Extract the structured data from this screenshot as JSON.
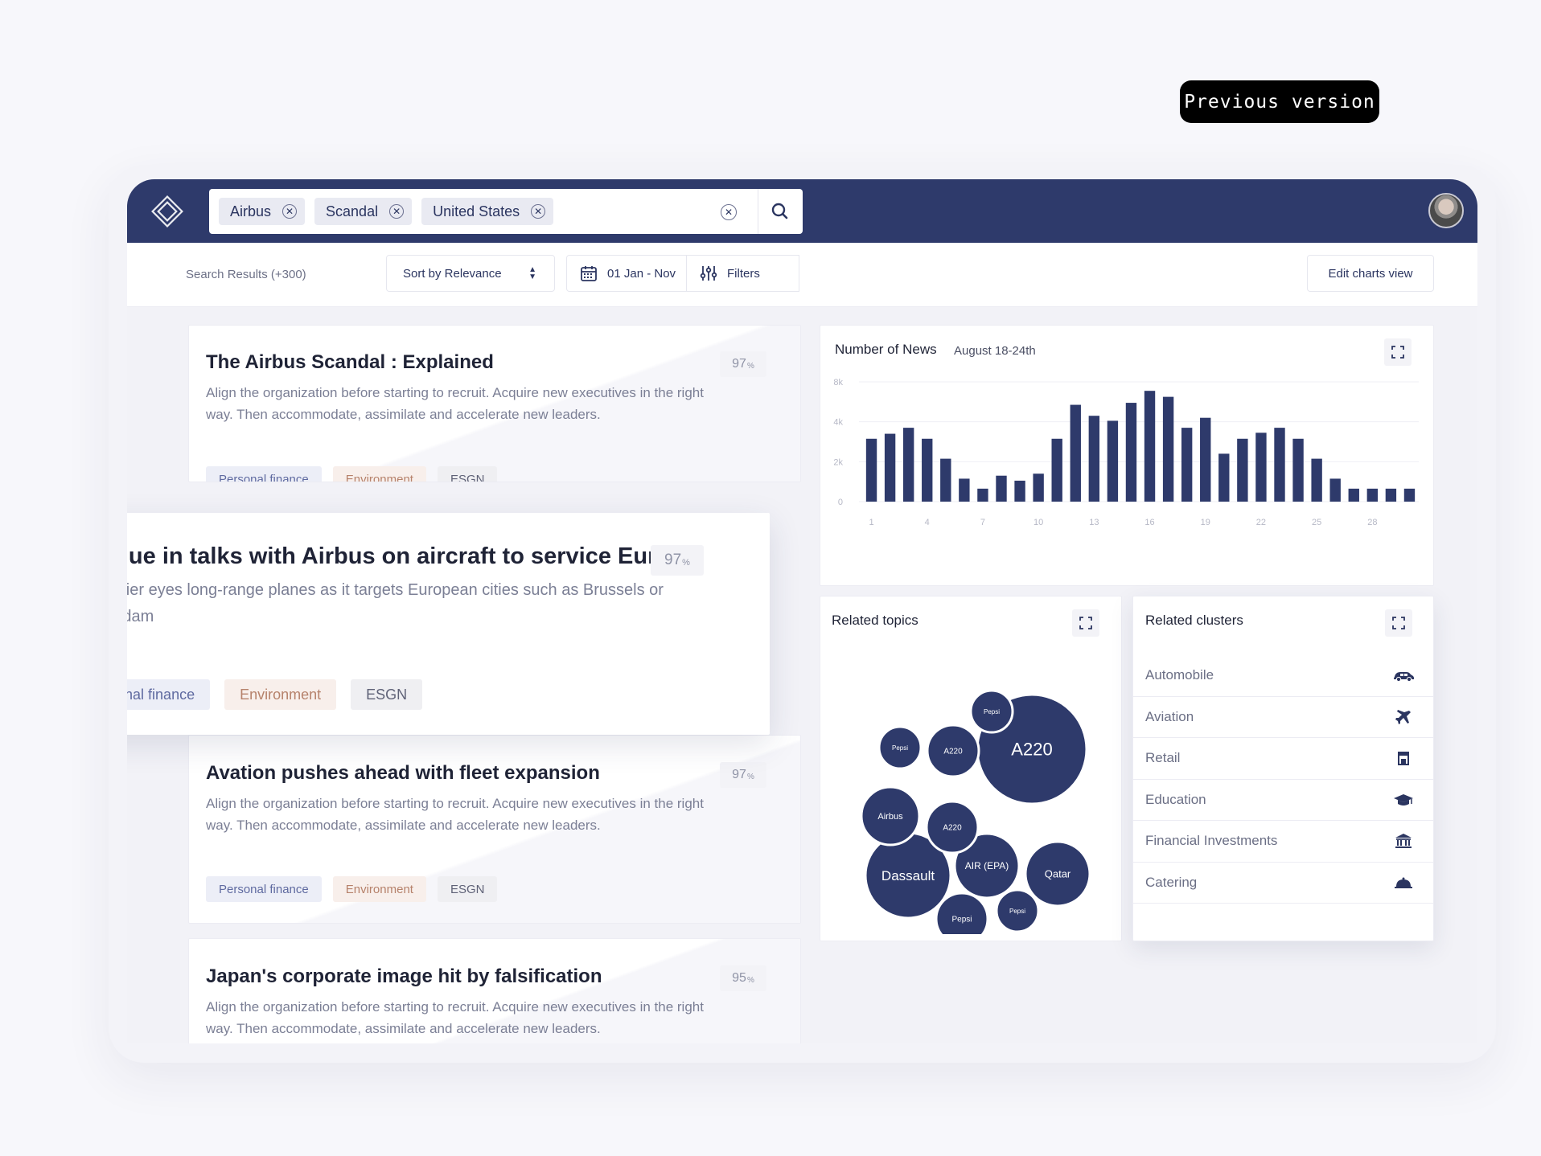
{
  "previous_version_label": "Previous version",
  "search": {
    "chips": [
      {
        "label": "Airbus"
      },
      {
        "label": "Scandal"
      },
      {
        "label": "United States"
      }
    ],
    "clear_icon": "close-icon",
    "submit_icon": "search-icon"
  },
  "toolbar": {
    "results_count": "Search Results (+300)",
    "sort_label": "Sort by Relevance",
    "date_label": "01 Jan - Nov",
    "filters_label": "Filters",
    "edit_charts_label": "Edit charts view"
  },
  "articles": [
    {
      "title": "The Airbus Scandal : Explained",
      "description": "Align the organization before starting to recruit. Acquire new executives in the right way. Then accommodate, assimilate and accelerate new leaders.",
      "score": "97",
      "score_unit": "%",
      "tags": [
        "Personal finance",
        "Environment",
        "ESGN"
      ]
    },
    {
      "title": "Avation pushes ahead with fleet expansion",
      "description": "Align the organization before starting to recruit. Acquire new executives in the right way. Then accommodate, assimilate and accelerate new leaders.",
      "score": "97",
      "score_unit": "%",
      "tags": [
        "Personal finance",
        "Environment",
        "ESGN"
      ]
    },
    {
      "title": "Japan's corporate image hit by falsification",
      "description": "Align the organization before starting to recruit. Acquire new executives in the right way. Then accommodate, assimilate and accelerate new leaders.",
      "score": "95",
      "score_unit": "%",
      "tags": []
    }
  ],
  "featured_article": {
    "title": "JetBlue in talks with Airbus on aircraft to service Europe",
    "description": "US carrier eyes long-range planes as it targets European cities such as Brussels or Amsterdam",
    "score": "97",
    "score_unit": "%",
    "tags": [
      "Personal finance",
      "Environment",
      "ESGN"
    ]
  },
  "news_chart": {
    "title": "Number of News",
    "subtitle": "August 18-24th"
  },
  "chart_data": {
    "type": "bar",
    "x": [
      1,
      2,
      3,
      4,
      5,
      6,
      7,
      8,
      9,
      10,
      11,
      12,
      13,
      14,
      15,
      16,
      17,
      18,
      19,
      20,
      21,
      22,
      23,
      24,
      25,
      26,
      27,
      28,
      29,
      30
    ],
    "x_tick_labels": [
      "1",
      "4",
      "7",
      "10",
      "13",
      "16",
      "19",
      "22",
      "25",
      "28"
    ],
    "x_ticks": [
      1,
      4,
      7,
      10,
      13,
      16,
      19,
      22,
      25,
      28
    ],
    "values": [
      3150,
      3400,
      3700,
      3150,
      2150,
      1150,
      650,
      1300,
      1050,
      1400,
      3150,
      4850,
      4300,
      4050,
      4950,
      5550,
      5250,
      3700,
      4200,
      2400,
      3150,
      3450,
      3700,
      3150,
      2150,
      1150,
      650,
      650,
      650,
      650
    ],
    "y_tick_labels": [
      "0",
      "2k",
      "4k",
      "8k"
    ],
    "y_ticks": [
      0,
      2000,
      4000,
      6000
    ],
    "ylim": [
      0,
      6000
    ],
    "grid": true,
    "bar_color": "#2e3a6b"
  },
  "related_topics": {
    "title": "Related topics",
    "bubbles": [
      {
        "label": "A220",
        "size": "large"
      },
      {
        "label": "Dassault",
        "size": "large"
      },
      {
        "label": "Qatar",
        "size": "medium"
      },
      {
        "label": "AIR (EPA)",
        "size": "medium"
      },
      {
        "label": "Airbus",
        "size": "medium"
      },
      {
        "label": "A220",
        "size": "small"
      },
      {
        "label": "A220",
        "size": "small"
      },
      {
        "label": "Pepsi",
        "size": "small"
      },
      {
        "label": "Pepsi",
        "size": "small"
      },
      {
        "label": "Pepsi",
        "size": "small"
      },
      {
        "label": "Pepsi",
        "size": "small"
      }
    ],
    "bubble_color": "#2e3a6b"
  },
  "related_clusters": {
    "title": "Related clusters",
    "items": [
      {
        "label": "Automobile",
        "icon": "car-icon"
      },
      {
        "label": "Aviation",
        "icon": "airplane-icon"
      },
      {
        "label": "Retail",
        "icon": "store-icon"
      },
      {
        "label": "Education",
        "icon": "graduation-cap-icon"
      },
      {
        "label": "Financial Investments",
        "icon": "bank-icon"
      },
      {
        "label": "Catering",
        "icon": "cloche-icon"
      }
    ]
  },
  "colors": {
    "topbar": "#2e3a6b",
    "accent": "#2e3a6b"
  }
}
